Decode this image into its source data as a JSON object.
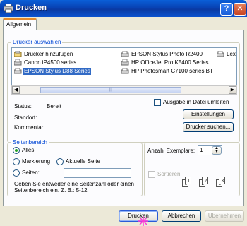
{
  "window": {
    "title": "Drucken",
    "help_label": "?",
    "close_label": "✕"
  },
  "tabs": [
    {
      "label": "Allgemein"
    }
  ],
  "printer_group": {
    "legend": "Drucker auswählen",
    "printers": [
      {
        "label": "Drucker hinzufügen",
        "icon": "add-printer-icon"
      },
      {
        "label": "Canon iP4500 series",
        "icon": "printer-icon"
      },
      {
        "label": "EPSON Stylus D88 Series",
        "icon": "printer-icon",
        "selected": true
      },
      {
        "label": "EPSON Stylus Photo R2400",
        "icon": "printer-icon"
      },
      {
        "label": "HP OfficeJet Pro K5400 Series",
        "icon": "printer-icon"
      },
      {
        "label": "HP Photosmart C7100 series BT",
        "icon": "printer-icon"
      },
      {
        "label": "Lex",
        "icon": "printer-icon"
      }
    ],
    "status_label": "Status:",
    "status_value": "Bereit",
    "location_label": "Standort:",
    "location_value": "",
    "comment_label": "Kommentar:",
    "comment_value": "",
    "print_to_file_label": "Ausgabe in Datei umleiten",
    "settings_button": "Einstellungen",
    "find_printer_button": "Drucker suchen..."
  },
  "range_group": {
    "legend": "Seitenbereich",
    "all_label": "Alles",
    "selection_label": "Markierung",
    "current_page_label": "Aktuelle Seite",
    "pages_label": "Seiten:",
    "pages_value": "",
    "hint": "Geben Sie entweder eine Seitenzahl oder einen Seitenbereich ein. Z. B.: 5-12"
  },
  "copies_group": {
    "copies_label": "Anzahl Exemplare:",
    "copies_value": "1",
    "collate_label": "Sortieren",
    "collate_sheets": [
      "1",
      "1",
      "2",
      "2",
      "3",
      "3"
    ]
  },
  "buttons": {
    "print": "Drucken",
    "cancel": "Abbrechen",
    "apply": "Übernehmen"
  }
}
